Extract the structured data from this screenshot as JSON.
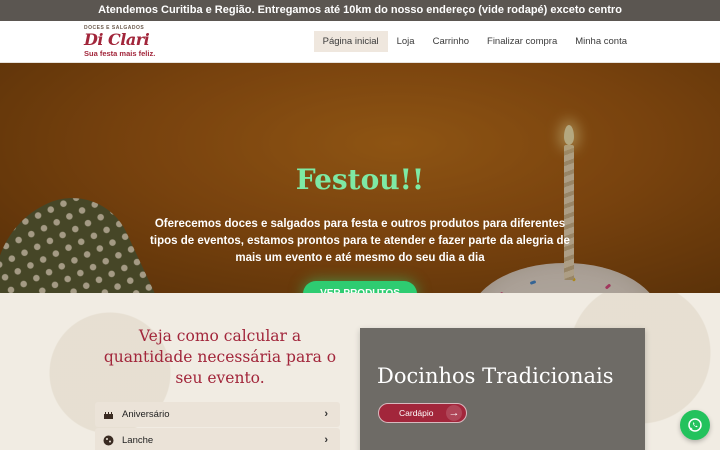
{
  "topbar": {
    "text": "Atendemos Curitiba e Região. Entregamos até 10km do nosso endereço (vide rodapé) exceto centro"
  },
  "logo": {
    "small": "DOCES E SALGADOS",
    "main": "Di Clari",
    "tagline": "Sua festa mais feliz."
  },
  "nav": {
    "items": [
      {
        "label": "Página inicial",
        "active": true
      },
      {
        "label": "Loja",
        "active": false
      },
      {
        "label": "Carrinho",
        "active": false
      },
      {
        "label": "Finalizar compra",
        "active": false
      },
      {
        "label": "Minha conta",
        "active": false
      }
    ]
  },
  "hero": {
    "title": "Festou!!",
    "text": "Oferecemos doces e salgados para festa e outros produtos para diferentes tipos de eventos, estamos prontos para te atender e fazer parte da alegria de mais um evento e até mesmo do seu dia a dia",
    "button": "VER PRODUTOS"
  },
  "calculator": {
    "title": "Veja como calcular a quantidade necessária para o seu evento.",
    "items": [
      {
        "label": "Aniversário",
        "icon": "cake-icon"
      },
      {
        "label": "Lanche",
        "icon": "cookie-icon"
      }
    ]
  },
  "card": {
    "title": "Docinhos Tradicionais",
    "button": "Cardápio"
  },
  "colors": {
    "brand": "#a2263b",
    "accent_green": "#2ecc71",
    "whatsapp": "#23c25d"
  }
}
